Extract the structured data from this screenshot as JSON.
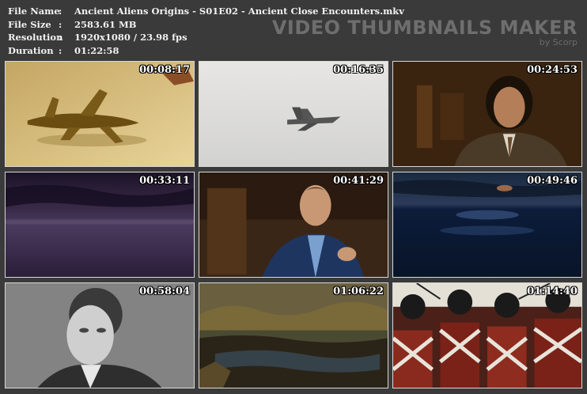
{
  "info": {
    "rows": [
      {
        "label": "File Name",
        "value": "Ancient Aliens Origins - S01E02 - Ancient Close Encounters.mkv"
      },
      {
        "label": "File Size",
        "value": "2583.61 MB"
      },
      {
        "label": "Resolution",
        "value": "1920x1080 / 23.98 fps"
      },
      {
        "label": "Duration",
        "value": "01:22:58"
      }
    ],
    "separator": ":"
  },
  "brand": {
    "title": "VIDEO THUMBNAILS MAKER",
    "subtitle": "by Scorp"
  },
  "thumbnails": [
    {
      "timestamp": "00:08:17",
      "scene": "gold-airplane-figurine"
    },
    {
      "timestamp": "00:16:35",
      "scene": "fighter-jet-in-sky"
    },
    {
      "timestamp": "00:24:53",
      "scene": "man-with-curly-hair"
    },
    {
      "timestamp": "00:33:11",
      "scene": "purple-clouds-horizon"
    },
    {
      "timestamp": "00:41:29",
      "scene": "man-in-blue-suit"
    },
    {
      "timestamp": "00:49:46",
      "scene": "night-ocean-with-light"
    },
    {
      "timestamp": "00:58:04",
      "scene": "engraved-portrait"
    },
    {
      "timestamp": "01:06:22",
      "scene": "marsh-creek"
    },
    {
      "timestamp": "01:14:40",
      "scene": "redcoat-soldiers"
    }
  ],
  "colors": {
    "background": "#3a3a3a",
    "text": "#f2f2f2",
    "brand": "#6e6e6e"
  }
}
